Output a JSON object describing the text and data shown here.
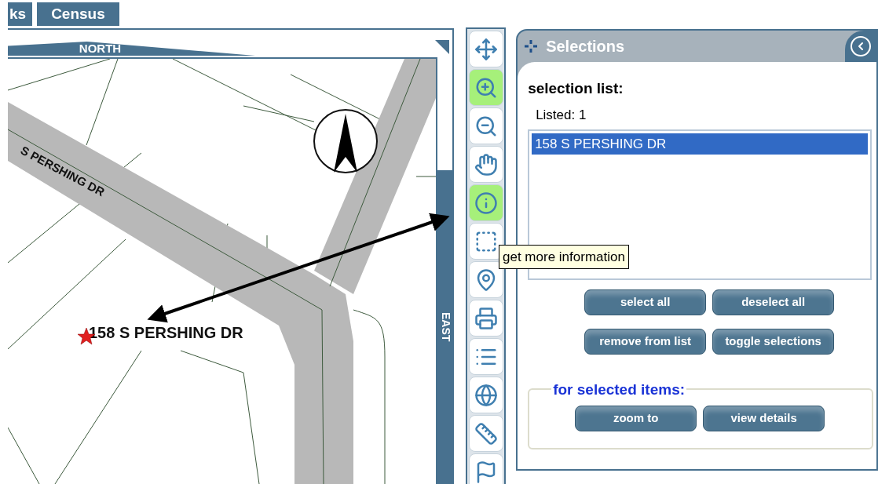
{
  "tabs": [
    {
      "label": "ks"
    },
    {
      "label": "Census"
    }
  ],
  "map": {
    "top_label": "NORTH",
    "side_label": "EAST",
    "street_label": "S PERSHING DR",
    "marker_label": "158 S PERSHING DR"
  },
  "toolbar": {
    "tools": [
      {
        "kind": "pan",
        "highlighted": false
      },
      {
        "kind": "zoom-in",
        "highlighted": true
      },
      {
        "kind": "zoom-out",
        "highlighted": false
      },
      {
        "kind": "hand",
        "highlighted": false
      },
      {
        "kind": "info",
        "highlighted": true
      },
      {
        "kind": "select-box",
        "highlighted": false
      },
      {
        "kind": "pin",
        "highlighted": false
      },
      {
        "kind": "print",
        "highlighted": false
      },
      {
        "kind": "list",
        "highlighted": false
      },
      {
        "kind": "globe",
        "highlighted": false
      },
      {
        "kind": "ruler",
        "highlighted": false
      },
      {
        "kind": "flag",
        "highlighted": false
      }
    ]
  },
  "tooltip": "get more information",
  "panel": {
    "title": "Selections",
    "list_heading": "selection list:",
    "count": "Listed: 1",
    "items": [
      {
        "label": "158 S PERSHING DR",
        "selected": true
      }
    ],
    "buttons": [
      "select all",
      "deselect all",
      "remove from list",
      "toggle selections"
    ],
    "group": {
      "legend": "for selected items:",
      "buttons": [
        "zoom to",
        "view details"
      ]
    }
  }
}
